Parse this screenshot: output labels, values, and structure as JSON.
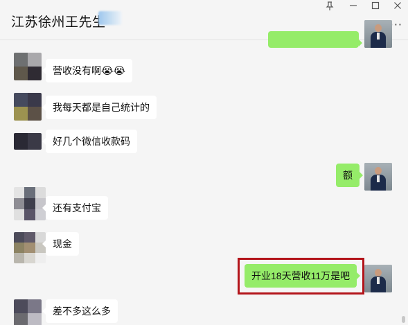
{
  "header": {
    "title": "江苏徐州王先生",
    "controls": {
      "pin_icon": "pin-icon",
      "minimize_icon": "minimize-icon",
      "maximize_icon": "maximize-icon",
      "close_icon": "close-icon",
      "more_icon": "more-icon"
    }
  },
  "messages": [
    {
      "side": "out",
      "text": "",
      "partial": true
    },
    {
      "side": "in",
      "text": "营收没有啊",
      "emoji": [
        "😭",
        "😭"
      ]
    },
    {
      "side": "in",
      "text": "我每天都是自己统计的"
    },
    {
      "side": "in",
      "text": "好几个微信收款码"
    },
    {
      "side": "out",
      "text": "额"
    },
    {
      "side": "in",
      "text": "还有支付宝"
    },
    {
      "side": "in",
      "text": "现金"
    },
    {
      "side": "out",
      "text": "开业18天营收11万是吧",
      "highlighted": true
    },
    {
      "side": "in",
      "text": "差不多这么多"
    }
  ],
  "colors": {
    "background": "#f5f5f5",
    "incoming_bubble": "#ffffff",
    "outgoing_bubble": "#95ec69",
    "highlight_border": "#b3141a"
  }
}
